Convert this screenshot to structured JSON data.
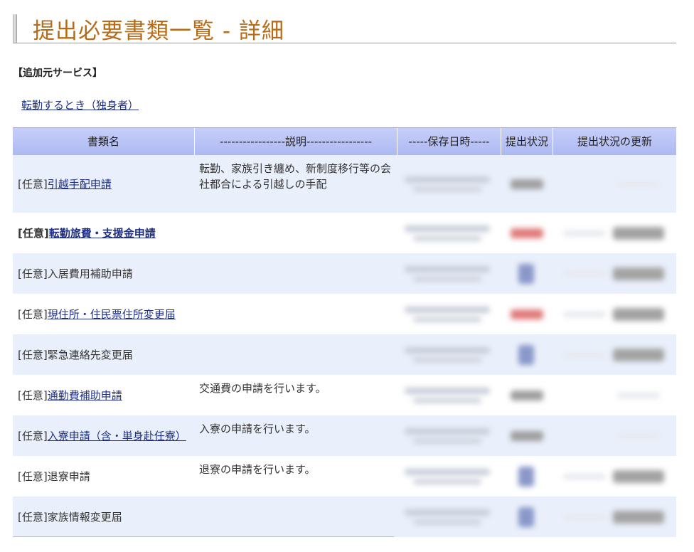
{
  "page": {
    "title": "提出必要書類一覧 - 詳細",
    "section_label": "【追加元サービス】",
    "service_link": "転勤するとき（独身者）"
  },
  "table": {
    "headers": [
      "書類名",
      "-----------------説明-----------------",
      "-----保存日時-----",
      "提出状況",
      "提出状況の更新"
    ],
    "rows": [
      {
        "prefix": "[任意]",
        "name": "引越手配申請",
        "link": true,
        "bold": false,
        "description": "転勤、家族引き纏め、新制度移行等の会社都合による引越しの手配"
      },
      {
        "prefix": "[任意]",
        "name": "転勤旅費・支援金申請",
        "link": true,
        "bold": true,
        "description": ""
      },
      {
        "prefix": "[任意]",
        "name": "入居費用補助申請",
        "link": false,
        "bold": false,
        "description": ""
      },
      {
        "prefix": "[任意]",
        "name": "現住所・住民票住所変更届",
        "link": true,
        "bold": false,
        "description": ""
      },
      {
        "prefix": "[任意]",
        "name": "緊急連絡先変更届",
        "link": false,
        "bold": false,
        "description": ""
      },
      {
        "prefix": "[任意]",
        "name": "通勤費補助申請",
        "link": true,
        "bold": false,
        "description": "交通費の申請を行います。"
      },
      {
        "prefix": "[任意]",
        "name": "入寮申請（含・単身赴任寮）",
        "link": true,
        "bold": false,
        "description": "入寮の申請を行います。"
      },
      {
        "prefix": "[任意]",
        "name": "退寮申請",
        "link": false,
        "bold": false,
        "description": "退寮の申請を行います。"
      },
      {
        "prefix": "[任意]",
        "name": "家族情報変更届",
        "link": false,
        "bold": false,
        "description": ""
      }
    ]
  },
  "colors": {
    "title": "#b86b16",
    "link": "#1f2f86",
    "header_bg": "#b6c0f4",
    "row_alt_bg": "#eaf0fb"
  }
}
